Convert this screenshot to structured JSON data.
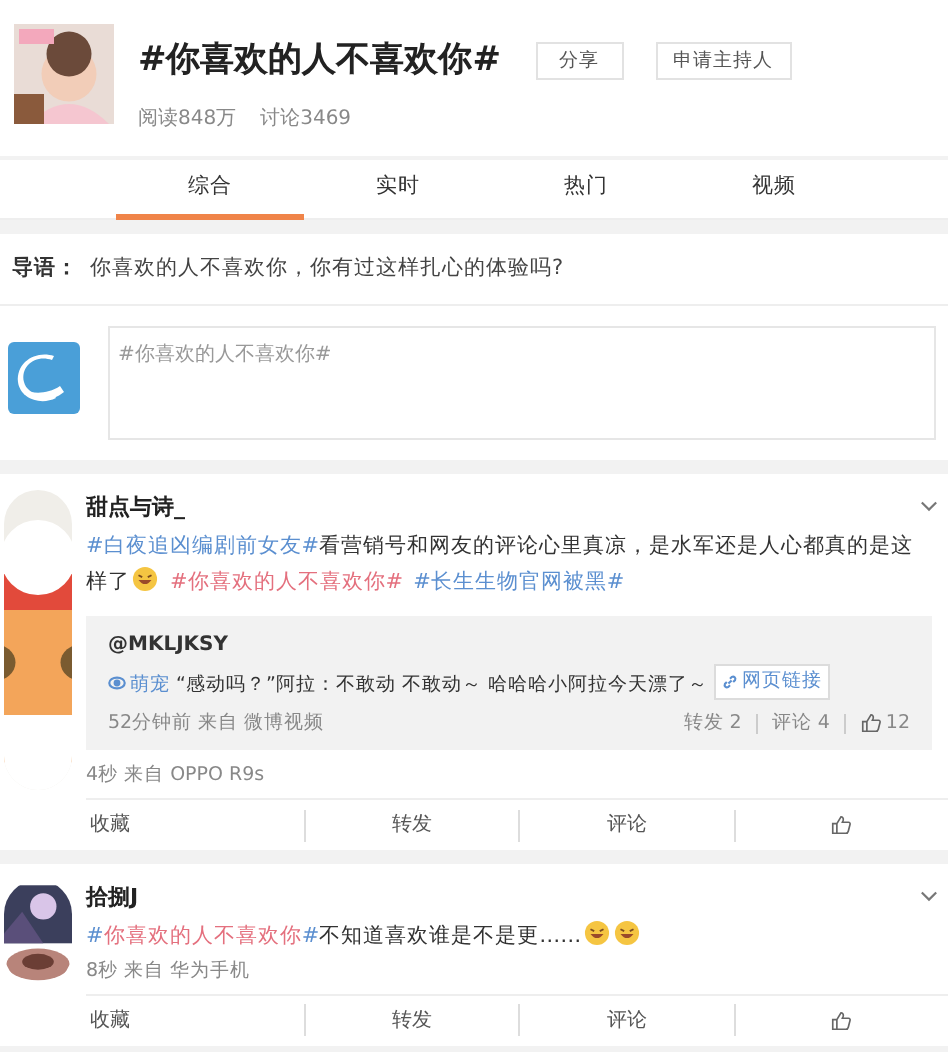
{
  "header": {
    "title": "#你喜欢的人不喜欢你#",
    "share_button": "分享",
    "host_button": "申请主持人",
    "stats": [
      "阅读848万",
      "讨论3469"
    ]
  },
  "tabs": [
    {
      "label": "综合",
      "selected": true
    },
    {
      "label": "实时",
      "selected": false
    },
    {
      "label": "热门",
      "selected": false
    },
    {
      "label": "视频",
      "selected": false
    }
  ],
  "intro": {
    "label": "导语：",
    "text": "你喜欢的人不喜欢你，你有过这样扎心的体验吗?"
  },
  "composer": {
    "placeholder": "#你喜欢的人不喜欢你#"
  },
  "posts": [
    {
      "author": "甜点与诗_",
      "segments": [
        {
          "kind": "topic",
          "text": "#白夜追凶编剧前女友#"
        },
        {
          "kind": "text",
          "text": "看营销号和网友的评论心里真凉，是水军还是人心都真的是这样了"
        },
        {
          "kind": "emoji"
        },
        {
          "kind": "space"
        },
        {
          "kind": "hot",
          "text": "#你喜欢的人不喜欢你#"
        },
        {
          "kind": "space"
        },
        {
          "kind": "topic",
          "text": "#长生生物官网被黑#"
        }
      ],
      "repost": {
        "author": "@MKLJKSY",
        "segments": [
          {
            "kind": "tag",
            "text": "萌宠"
          },
          {
            "kind": "text",
            "text": " “感动吗？”阿拉：不敢动 不敢动～ 哈哈哈小阿拉今天漂了～ "
          },
          {
            "kind": "link",
            "text": "网页链接"
          }
        ],
        "meta": "52分钟前 来自 微博视频",
        "stats": [
          {
            "kind": "text",
            "label": "转发 2"
          },
          {
            "kind": "text",
            "label": "评论 4"
          },
          {
            "kind": "like",
            "label": "12"
          }
        ]
      },
      "meta": "4秒 来自 OPPO R9s",
      "actions": [
        {
          "kind": "text",
          "label": "收藏"
        },
        {
          "kind": "text",
          "label": "转发"
        },
        {
          "kind": "text",
          "label": "评论"
        },
        {
          "kind": "like"
        }
      ]
    },
    {
      "author": "拾捌J",
      "segments": [
        {
          "kind": "topic",
          "text": "#"
        },
        {
          "kind": "hot",
          "text": "你喜欢的人不喜欢你"
        },
        {
          "kind": "topic",
          "text": "#"
        },
        {
          "kind": "text",
          "text": "不知道喜欢谁是不是更……"
        },
        {
          "kind": "emoji"
        },
        {
          "kind": "emoji"
        }
      ],
      "meta": "8秒 来自 华为手机",
      "actions": [
        {
          "kind": "text",
          "label": "收藏"
        },
        {
          "kind": "text",
          "label": "转发"
        },
        {
          "kind": "text",
          "label": "评论"
        },
        {
          "kind": "like"
        }
      ]
    }
  ]
}
